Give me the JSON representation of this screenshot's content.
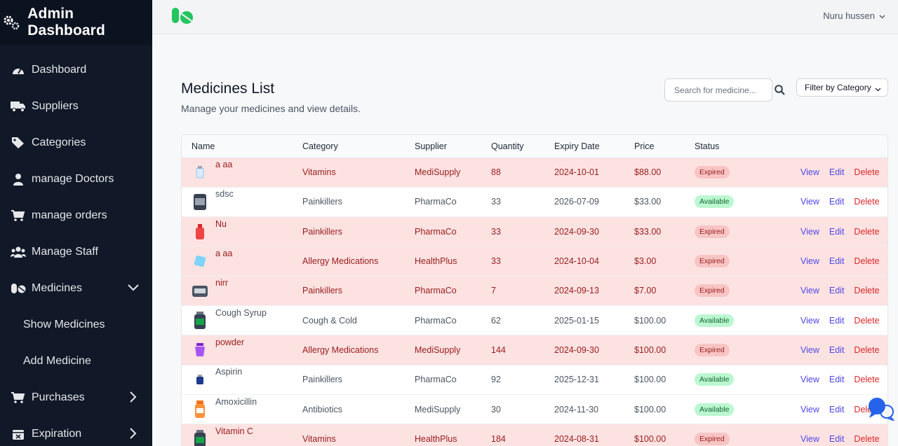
{
  "sidebar": {
    "title": "Admin Dashboard",
    "items": [
      {
        "label": "Dashboard",
        "icon": "dashboard-icon"
      },
      {
        "label": "Suppliers",
        "icon": "truck-icon"
      },
      {
        "label": "Categories",
        "icon": "tags-icon"
      },
      {
        "label": "manage Doctors",
        "icon": "doctor-icon"
      },
      {
        "label": "manage orders",
        "icon": "cart-icon"
      },
      {
        "label": "Manage Staff",
        "icon": "users-icon"
      },
      {
        "label": "Medicines",
        "icon": "pills-icon"
      },
      {
        "label": "Show Medicines"
      },
      {
        "label": "Add Medicine"
      },
      {
        "label": "Purchases",
        "icon": "cart-icon"
      },
      {
        "label": "Expiration",
        "icon": "calendar-icon"
      }
    ]
  },
  "topbar": {
    "user": "Nuru hussen"
  },
  "page": {
    "title": "Medicines List",
    "subtitle": "Manage your medicines and view details.",
    "search_placeholder": "Search for medicine...",
    "filter_label": "Filter by Category"
  },
  "table": {
    "headers": [
      "Name",
      "Category",
      "Supplier",
      "Quantity",
      "Expiry Date",
      "Price",
      "Status"
    ],
    "actions": {
      "view": "View",
      "edit": "Edit",
      "delete": "Delete"
    },
    "rows": [
      {
        "name": "a aa",
        "category": "Vitamins",
        "supplier": "MediSupply",
        "quantity": "88",
        "expiry": "2024-10-01",
        "price": "$88.00",
        "status": "Expired"
      },
      {
        "name": "sdsc",
        "category": "Painkillers",
        "supplier": "PharmaCo",
        "quantity": "33",
        "expiry": "2026-07-09",
        "price": "$33.00",
        "status": "Available"
      },
      {
        "name": "Nu",
        "category": "Painkillers",
        "supplier": "PharmaCo",
        "quantity": "33",
        "expiry": "2024-09-30",
        "price": "$33.00",
        "status": "Expired"
      },
      {
        "name": "a aa",
        "category": "Allergy Medications",
        "supplier": "HealthPlus",
        "quantity": "33",
        "expiry": "2024-10-04",
        "price": "$3.00",
        "status": "Expired"
      },
      {
        "name": "nirr",
        "category": "Painkillers",
        "supplier": "PharmaCo",
        "quantity": "7",
        "expiry": "2024-09-13",
        "price": "$7.00",
        "status": "Expired"
      },
      {
        "name": "Cough Syrup",
        "category": "Cough & Cold",
        "supplier": "PharmaCo",
        "quantity": "62",
        "expiry": "2025-01-15",
        "price": "$100.00",
        "status": "Available"
      },
      {
        "name": "powder",
        "category": "Allergy Medications",
        "supplier": "MediSupply",
        "quantity": "144",
        "expiry": "2024-09-30",
        "price": "$100.00",
        "status": "Expired"
      },
      {
        "name": "Aspirin",
        "category": "Painkillers",
        "supplier": "PharmaCo",
        "quantity": "92",
        "expiry": "2025-12-31",
        "price": "$100.00",
        "status": "Available"
      },
      {
        "name": "Amoxicillin",
        "category": "Antibiotics",
        "supplier": "MediSupply",
        "quantity": "30",
        "expiry": "2024-11-30",
        "price": "$100.00",
        "status": "Available"
      },
      {
        "name": "Vitamin C",
        "category": "Vitamins",
        "supplier": "HealthPlus",
        "quantity": "184",
        "expiry": "2024-08-31",
        "price": "$100.00",
        "status": "Expired"
      }
    ]
  },
  "colors": {
    "sidebar": "#111827",
    "brand_green": "#22c55e",
    "link": "#4f46e5",
    "danger": "#dc2626",
    "expired_row": "#fde2e2"
  }
}
